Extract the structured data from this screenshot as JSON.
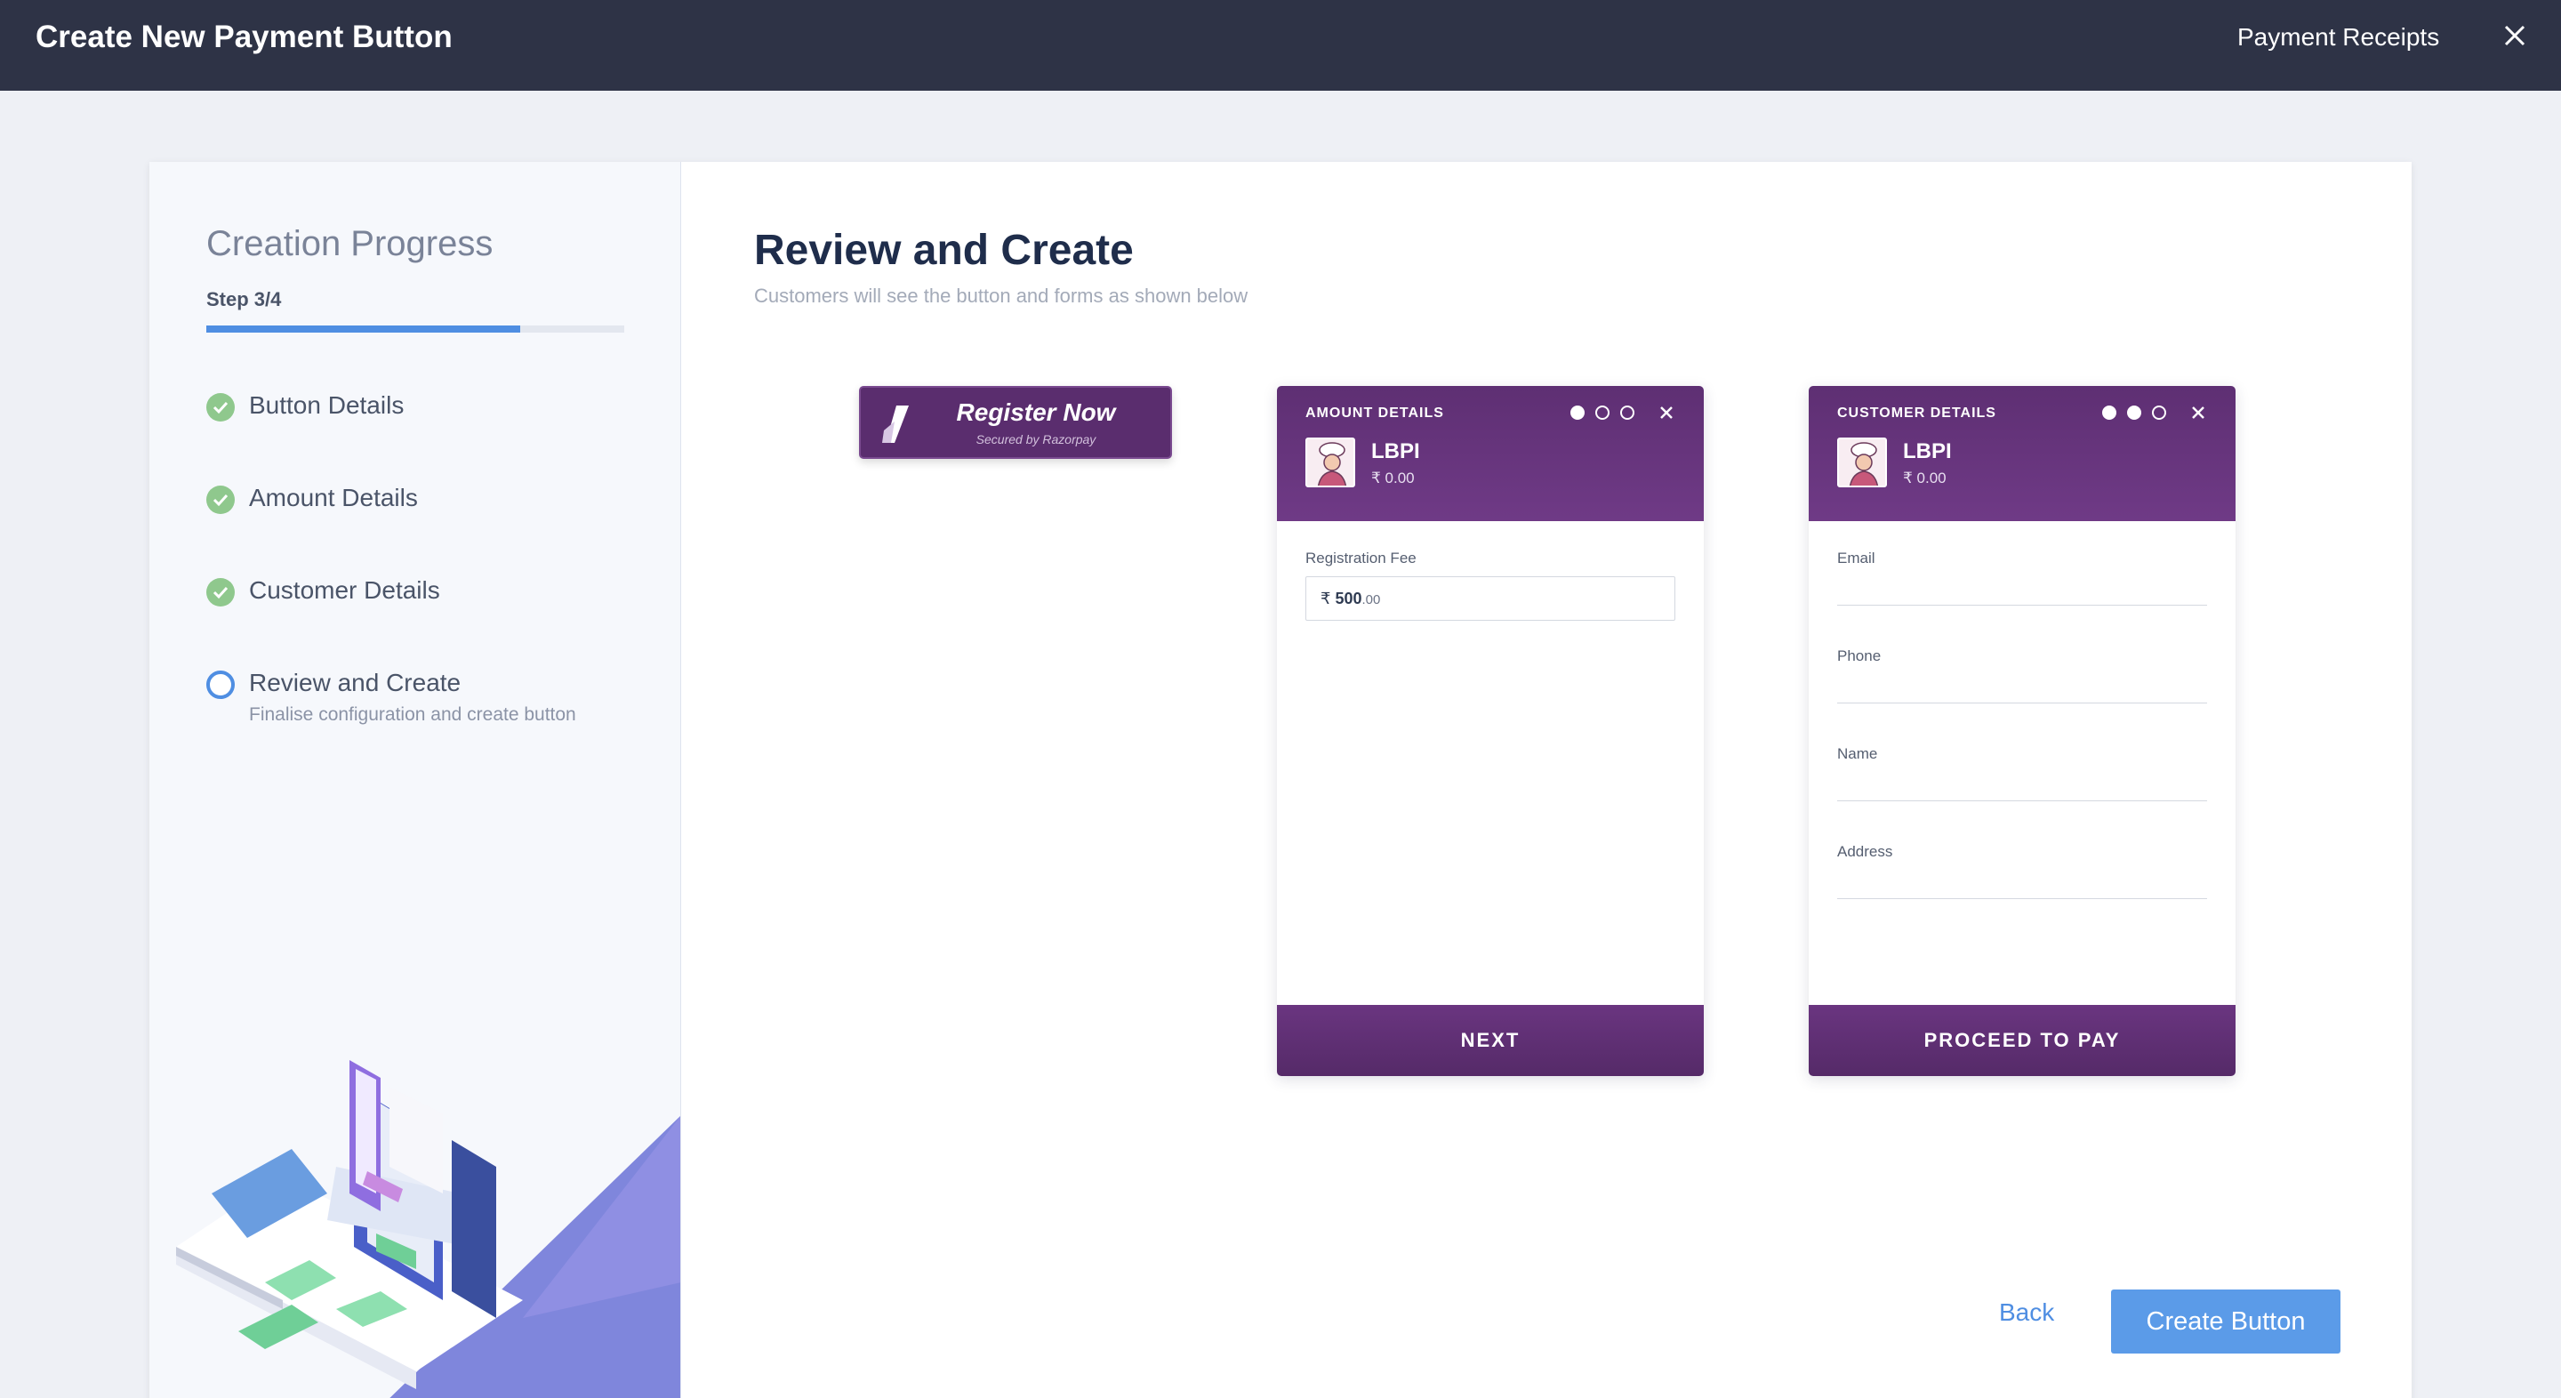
{
  "topbar": {
    "title": "Create New Payment Button",
    "receipts_link": "Payment Receipts",
    "close_icon": "close-icon"
  },
  "sidebar": {
    "heading": "Creation Progress",
    "step_text": "Step 3/4",
    "progress_fraction": 0.75,
    "steps": [
      {
        "label": "Button Details",
        "status": "done"
      },
      {
        "label": "Amount Details",
        "status": "done"
      },
      {
        "label": "Customer Details",
        "status": "done"
      },
      {
        "label": "Review and Create",
        "sublabel": "Finalise configuration and create button",
        "status": "current"
      }
    ]
  },
  "main": {
    "title": "Review and Create",
    "subtitle": "Customers will see the button and forms as shown below"
  },
  "preview_button": {
    "label": "Register Now",
    "secured": "Secured by Razorpay"
  },
  "amount_form": {
    "section": "AMOUNT DETAILS",
    "merchant": "LBPI",
    "amount": "₹ 0.00",
    "field_label": "Registration Fee",
    "field_currency": "₹",
    "field_value": "500",
    "field_decimals": ".00",
    "footer": "NEXT"
  },
  "customer_form": {
    "section": "CUSTOMER DETAILS",
    "merchant": "LBPI",
    "amount": "₹ 0.00",
    "fields": [
      "Email",
      "Phone",
      "Name",
      "Address"
    ],
    "footer": "PROCEED TO PAY"
  },
  "actions": {
    "back": "Back",
    "create": "Create Button"
  },
  "colors": {
    "topbar": "#2e3346",
    "accent": "#4f8ee2",
    "done": "#8fc88d",
    "brand_purple": "#5e2f73"
  }
}
